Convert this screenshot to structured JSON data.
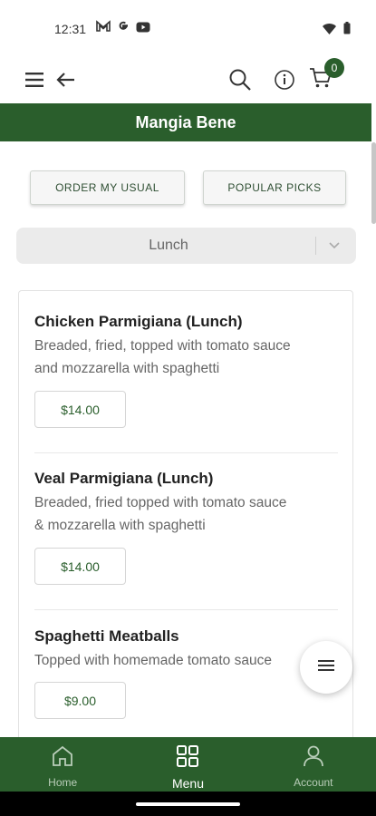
{
  "status": {
    "time": "12:31",
    "left_icons": [
      "gmail-icon",
      "google-icon",
      "youtube-icon"
    ],
    "right_icons": [
      "wifi-icon",
      "battery-icon"
    ]
  },
  "app_bar": {
    "cart_count": "0",
    "icons": [
      "hamburger-menu-icon",
      "back-arrow-icon",
      "search-icon",
      "info-icon",
      "cart-icon"
    ]
  },
  "restaurant": {
    "name": "Mangia Bene"
  },
  "quick_actions": {
    "order_usual": "ORDER MY USUAL",
    "popular_picks": "POPULAR PICKS"
  },
  "menu_select": {
    "selected": "Lunch"
  },
  "menu_items": [
    {
      "name": "Chicken Parmigiana (Lunch)",
      "desc_line1": "Breaded, fried, topped with tomato sauce",
      "desc_line2": "and mozzarella with spaghetti",
      "price": "$14.00"
    },
    {
      "name": "Veal Parmigiana (Lunch)",
      "desc_line1": "Breaded, fried topped with tomato sauce",
      "desc_line2": "& mozzarella with spaghetti",
      "price": "$14.00"
    },
    {
      "name": "Spaghetti Meatballs",
      "desc_line1": "Topped with homemade tomato sauce",
      "price": "$9.00"
    }
  ],
  "bottom_nav": {
    "home": "Home",
    "menu": "Menu",
    "account": "Account",
    "active": "menu"
  },
  "colors": {
    "brand_green": "#2a5e2c",
    "background": "#ffffff"
  }
}
